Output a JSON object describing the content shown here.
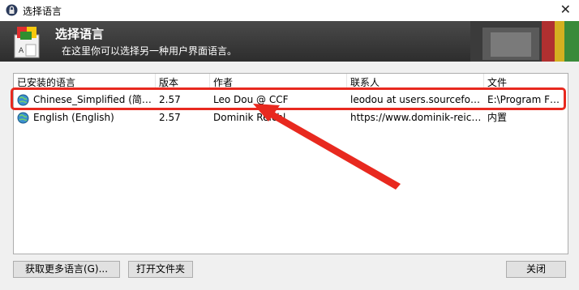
{
  "window": {
    "title": "选择语言",
    "close_glyph": "✕"
  },
  "banner": {
    "title": "选择语言",
    "subtitle": "在这里你可以选择另一种用户界面语言。"
  },
  "list": {
    "columns": [
      "已安装的语言",
      "版本",
      "作者",
      "联系人",
      "文件"
    ],
    "rows": [
      {
        "language": "Chinese_Simplified (简…",
        "version": "2.57",
        "author": "Leo Dou @ CCF",
        "contact": "leodou at users.sourcefo…",
        "file": "E:\\Program F…",
        "selected": true
      },
      {
        "language": "English (English)",
        "version": "2.57",
        "author": "Dominik Reichl",
        "contact": "https://www.dominik-reic…",
        "file": "内置",
        "selected": false
      }
    ]
  },
  "buttons": {
    "more": "获取更多语言(G)...",
    "open_folder": "打开文件夹",
    "close": "关闭"
  },
  "icons": {
    "title": "lock-icon",
    "banner": "language-books-icon",
    "row": "globe-icon"
  },
  "colors": {
    "annotation_red": "#e8291f",
    "banner_bg": "#3a3a3a"
  }
}
